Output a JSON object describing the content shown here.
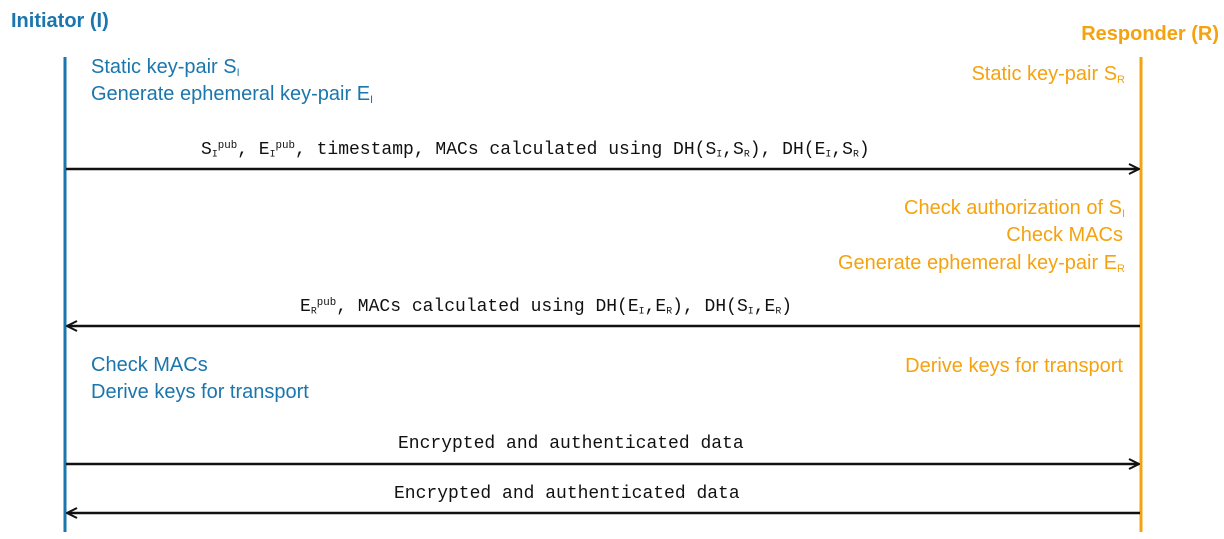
{
  "colors": {
    "initiator": "#1a76ad",
    "responder": "#f5a20f",
    "arrow": "#111111"
  },
  "initiator": {
    "title": "Initiator (I)"
  },
  "responder": {
    "title": "Responder (R)"
  },
  "notes": {
    "i_static": "Static key-pair S",
    "i_static_sub": "I",
    "i_generate": "Generate ephemeral key-pair E",
    "i_generate_sub": "I",
    "r_static": "Static key-pair S",
    "r_static_sub": "R",
    "r_check_auth": "Check authorization of S",
    "r_check_auth_sub": "I",
    "r_check_macs": "Check MACs",
    "r_generate": "Generate ephemeral key-pair E",
    "r_generate_sub": "R",
    "i_check_macs": "Check MACs",
    "i_derive": "Derive keys for transport",
    "r_derive": "Derive keys for transport"
  },
  "messages": {
    "m1": {
      "direction": "right",
      "parts": [
        {
          "t": "S"
        },
        {
          "sub": "I"
        },
        {
          "sup": "pub"
        },
        {
          "t": ", E"
        },
        {
          "sub": "I"
        },
        {
          "sup": "pub"
        },
        {
          "t": ", timestamp, MACs calculated using DH(S"
        },
        {
          "sub": "I"
        },
        {
          "t": ",S"
        },
        {
          "sub": "R"
        },
        {
          "t": "), DH(E"
        },
        {
          "sub": "I"
        },
        {
          "t": ",S"
        },
        {
          "sub": "R"
        },
        {
          "t": ")"
        }
      ]
    },
    "m2": {
      "direction": "left",
      "parts": [
        {
          "t": "E"
        },
        {
          "sub": "R"
        },
        {
          "sup": "pub"
        },
        {
          "t": ", MACs calculated using DH(E"
        },
        {
          "sub": "I"
        },
        {
          "t": ",E"
        },
        {
          "sub": "R"
        },
        {
          "t": "), DH(S"
        },
        {
          "sub": "I"
        },
        {
          "t": ",E"
        },
        {
          "sub": "R"
        },
        {
          "t": ")"
        }
      ]
    },
    "m3": {
      "direction": "right",
      "label": "Encrypted and authenticated data"
    },
    "m4": {
      "direction": "left",
      "label": "Encrypted and authenticated data"
    }
  }
}
